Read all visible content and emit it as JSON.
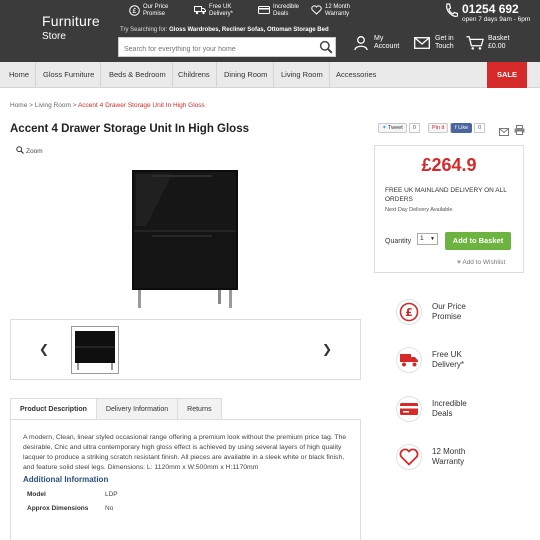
{
  "header": {
    "logo_line1": "Furniture",
    "logo_line2": "Store",
    "usps": [
      {
        "icon": "pound-circle-icon",
        "line1": "Our Price",
        "line2": "Promise"
      },
      {
        "icon": "truck-icon",
        "line1": "Free UK",
        "line2": "Delivery*"
      },
      {
        "icon": "card-icon",
        "line1": "Incredible",
        "line2": "Deals"
      },
      {
        "icon": "heart-icon",
        "line1": "12 Month",
        "line2": "Warranty"
      }
    ],
    "phone": "01254 692",
    "hours": "open 7 days 9am - 6pm",
    "try_label": "Try Searching for:",
    "try_terms": "Gloss Wardrobes, Recliner Sofas, Ottoman Storage Bed",
    "search_placeholder": "Search for everything for your home",
    "account_line1": "My",
    "account_line2": "Account",
    "touch_line1": "Get in",
    "touch_line2": "Touch",
    "basket_line1": "Basket",
    "basket_line2": "£0.00"
  },
  "nav": {
    "items": [
      "Home",
      "Gloss Furniture",
      "Beds & Bedroom",
      "Childrens",
      "Dining Room",
      "Living Room",
      "Accessories"
    ],
    "sale": "SALE"
  },
  "breadcrumb": {
    "home": "Home",
    "sep1": " > ",
    "living": "Living Room",
    "sep2": " > ",
    "current": "Accent 4 Drawer Storage Unit In High Gloss"
  },
  "product": {
    "title": "Accent 4 Drawer Storage Unit In High Gloss",
    "zoom": "Zoom",
    "tweet": "Tweet",
    "tweet_count": "0",
    "pin": "Pin it",
    "pin_count": "0",
    "like": "Like",
    "like_count": "0",
    "price": "£264.9",
    "delivery": "FREE UK MAINLAND DELIVERY ON ALL ORDERS",
    "next_day": "Next Day Delivery Available",
    "qty_label": "Quantity",
    "qty_value": "1",
    "add_to_basket": "Add to Basket",
    "wishlist": "Add to Wishlist",
    "colors": {
      "price": "#d62a2a",
      "add_button": "#6db33f",
      "header": "#3b3b3b"
    }
  },
  "tabs": [
    "Product Description",
    "Delivery Information",
    "Returns"
  ],
  "description": "A modern, Clean, linear styled occasional range offering a premium look without the premium price tag. The desirable, Chic and ultra contemporary high gloss effect is achieved by using several layers of high quality lacquer to produce a striking scratch resistant finish. All pieces are available in a sleek white or black finish, and feature solid steel legs. Dimensions: L: 1120mm x W:500mm x H:1170mm",
  "additional": {
    "heading": "Additional Information",
    "rows": [
      {
        "key": "Model",
        "value": "LDP"
      },
      {
        "key": "Approx Dimensions",
        "value": "No"
      }
    ]
  },
  "features": [
    {
      "icon": "pound-circle-icon",
      "line1": "Our Price",
      "line2": "Promise"
    },
    {
      "icon": "truck-icon",
      "line1": "Free UK",
      "line2": "Delivery*"
    },
    {
      "icon": "card-icon",
      "line1": "Incredible",
      "line2": "Deals"
    },
    {
      "icon": "heart-icon",
      "line1": "12 Month",
      "line2": "Warranty"
    }
  ]
}
